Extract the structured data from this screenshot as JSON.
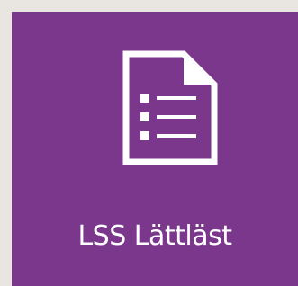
{
  "tile": {
    "label": "LSS Lättläst",
    "icon": "document-list-icon",
    "background_color": "#7a378c",
    "page_background_color": "#e9e6e1"
  }
}
